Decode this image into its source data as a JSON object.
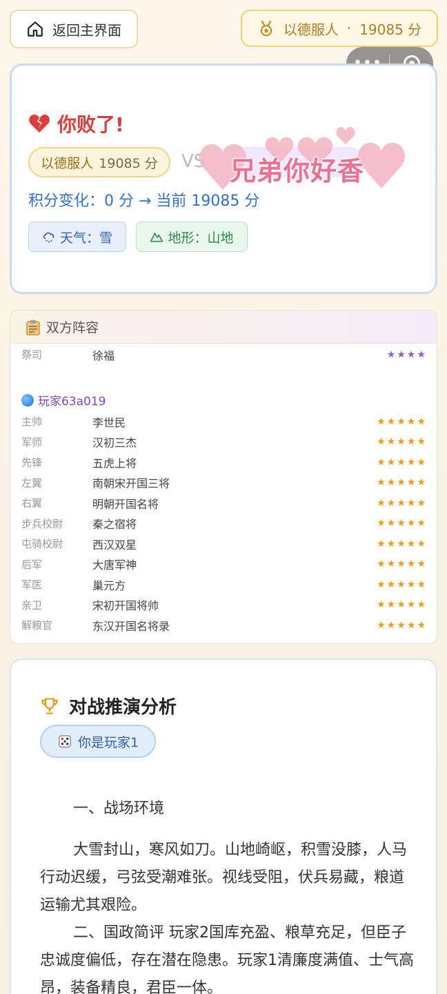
{
  "topbar": {
    "home_label": "返回主界面",
    "player_name": "以德服人",
    "separator": "·",
    "player_score": "19085 分"
  },
  "result": {
    "title": "你败了!",
    "self_name": "以德服人",
    "self_score": "19085 分",
    "vs": "VS",
    "overlay_text": "兄弟你好香",
    "score_change": "积分变化：0 分 → 当前 19085 分",
    "weather": "天气：雪",
    "terrain": "地形：山地"
  },
  "lineup": {
    "title": "双方阵容",
    "opponent_rows": [
      {
        "role": "祭司",
        "hero": "徐福",
        "stars": "★★★★"
      }
    ],
    "player_label": "玩家63a019",
    "player_rows": [
      {
        "role": "主帅",
        "hero": "李世民",
        "stars": "★★★★★"
      },
      {
        "role": "军师",
        "hero": "汉初三杰",
        "stars": "★★★★★"
      },
      {
        "role": "先锋",
        "hero": "五虎上将",
        "stars": "★★★★★"
      },
      {
        "role": "左翼",
        "hero": "南朝宋开国三将",
        "stars": "★★★★★"
      },
      {
        "role": "右翼",
        "hero": "明朝开国名将",
        "stars": "★★★★★"
      },
      {
        "role": "步兵校尉",
        "hero": "秦之宿将",
        "stars": "★★★★★"
      },
      {
        "role": "屯骑校尉",
        "hero": "西汉双星",
        "stars": "★★★★★"
      },
      {
        "role": "后军",
        "hero": "大唐军神",
        "stars": "★★★★★"
      },
      {
        "role": "军医",
        "hero": "巢元方",
        "stars": "★★★★★"
      },
      {
        "role": "亲卫",
        "hero": "宋初开国将帅",
        "stars": "★★★★★"
      },
      {
        "role": "解粮官",
        "hero": "东汉开国名将录",
        "stars": "★★★★★"
      }
    ]
  },
  "analysis": {
    "title": "对战推演分析",
    "role_label": "你是玩家1",
    "p1": "一、战场环境",
    "p2": "大雪封山，寒风如刀。山地崎岖，积雪没膝，人马行动迟缓，弓弦受潮难张。视线受阻，伏兵易藏，粮道运输尤其艰险。",
    "p3": "二、国政简评 玩家2国库充盈、粮草充足，但臣子忠诚度偏低，存在潜在隐患。玩家1清廉度满值、士气高昂，装备精良，君臣一体。"
  },
  "colors": {
    "lose_red": "#e03b3b",
    "score_blue": "#2f6fd6",
    "star_orange": "#f29a1a",
    "star_purple": "#8b5cd6",
    "player_purple": "#7b45c9"
  },
  "icons": {
    "home": "home-icon",
    "medal": "medal-icon",
    "broken_heart": "broken-heart-icon",
    "weather": "snow-cloud-icon",
    "terrain": "mountain-icon",
    "clipboard": "clipboard-icon",
    "player": "blue-orb-icon",
    "trophy": "trophy-icon",
    "dice": "dice-icon"
  }
}
